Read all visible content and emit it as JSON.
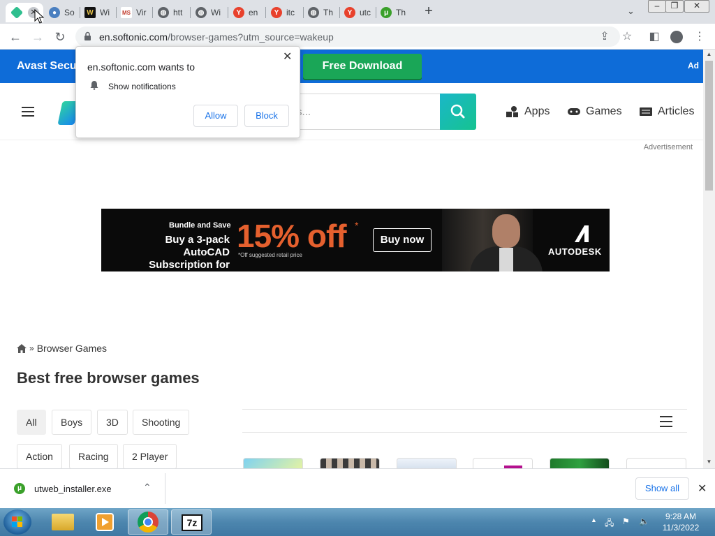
{
  "browser": {
    "tabs": [
      {
        "title": "",
        "favicon_color": "#2fbf8f",
        "active": true
      },
      {
        "title": "So",
        "favicon_color": "#4a7fc0"
      },
      {
        "title": "Wi",
        "favicon_color": "#111111",
        "favicon_letter": "W"
      },
      {
        "title": "Vir",
        "favicon_color": "#c0392b",
        "favicon_letter": "MS"
      },
      {
        "title": "htt",
        "favicon_color": "#5f6368"
      },
      {
        "title": "Wi",
        "favicon_color": "#5f6368"
      },
      {
        "title": "en",
        "favicon_color": "#e8412c",
        "favicon_letter": "Y"
      },
      {
        "title": "itc",
        "favicon_color": "#e8412c",
        "favicon_letter": "Y"
      },
      {
        "title": "Th",
        "favicon_color": "#5f6368"
      },
      {
        "title": "utc",
        "favicon_color": "#e8412c",
        "favicon_letter": "Y"
      },
      {
        "title": "Th",
        "favicon_color": "#3aa02a",
        "favicon_letter": "μ"
      }
    ],
    "url_host": "en.softonic.com",
    "url_path": "/browser-games?utm_source=wakeup"
  },
  "ad_bar": {
    "brand": "Avast Secur",
    "cta": "Free Download",
    "tag": "Ad"
  },
  "header": {
    "search_placeholder": "s...",
    "nav": [
      {
        "label": "Apps",
        "icon": "apps-icon"
      },
      {
        "label": "Games",
        "icon": "gamepad-icon"
      },
      {
        "label": "Articles",
        "icon": "articles-icon"
      }
    ]
  },
  "advertisement_label": "Advertisement",
  "banner": {
    "kicker": "Bundle and Save",
    "line1": "Buy a 3-pack AutoCAD",
    "line2": "Subscription for",
    "discount": "15% off",
    "asterisk": "*",
    "fine_print": "*Off suggested retail price",
    "cta": "Buy now",
    "brand": "AUTODESK"
  },
  "breadcrumb": {
    "separator": "»",
    "label": "Browser Games"
  },
  "page_title": "Best free browser games",
  "filters": [
    "All",
    "Boys",
    "3D",
    "Shooting",
    "Action",
    "Racing",
    "2 Player"
  ],
  "notification": {
    "origin": "en.softonic.com wants to",
    "permission": "Show notifications",
    "allow": "Allow",
    "block": "Block"
  },
  "download_shelf": {
    "file": "utweb_installer.exe",
    "show_all": "Show all"
  },
  "taskbar": {
    "time": "9:28 AM",
    "date": "11/3/2022"
  },
  "colors": {
    "ad_blue": "#0e6cd8",
    "cta_green": "#1aa657",
    "banner_orange": "#e5602e",
    "link_blue": "#1a73e8"
  }
}
